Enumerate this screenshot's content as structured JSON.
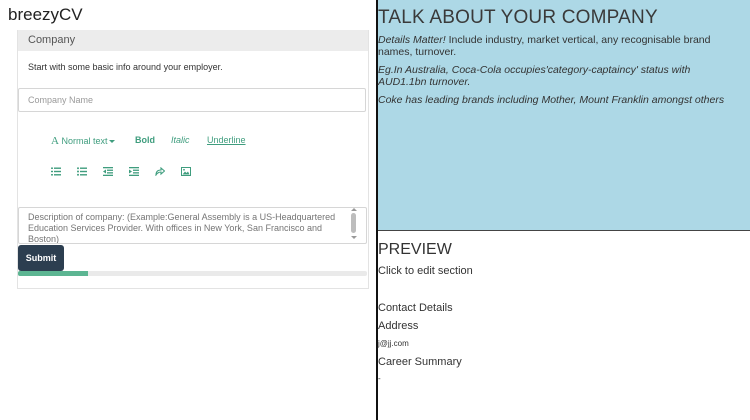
{
  "brand": "breezyCV",
  "form": {
    "panel_title": "Company",
    "intro": "Start with some basic info around your employer.",
    "company_placeholder": "Company Name",
    "toolbar": {
      "normal_icon": "A",
      "normal_label": "Normal text",
      "bold": "Bold",
      "italic": "Italic",
      "underline": "Underline",
      "icons": [
        "list-ordered-icon",
        "list-unordered-icon",
        "outdent-icon",
        "indent-icon",
        "link-icon",
        "image-icon"
      ]
    },
    "description_placeholder": "Description of company: (Example:General Assembly is a US-Headquartered Education Services Provider. With offices in New York, San Francisco and Boston)",
    "submit_label": "Submit",
    "progress": 0.2
  },
  "talk": {
    "title": "TALK ABOUT YOUR COMPANY",
    "p1_em": "Details Matter!",
    "p1_rest": " Include industry, market vertical, any recognisable brand names, turnover.",
    "p2": "Eg.In Australia, Coca-Cola occupies'category-captaincy' status with AUD1.1bn turnover.",
    "p3": "Coke has leading brands including Mother, Mount Franklin amongst others"
  },
  "preview": {
    "title": "PREVIEW",
    "hint": "Click to edit section",
    "contact": "Contact Details",
    "address": "Address",
    "email": "j@jj.com",
    "career": "Career Summary",
    "placeholder": "-"
  },
  "colors": {
    "accent": "#3f9d7e",
    "submit_bg": "#2c3e50",
    "progress_fill": "#5cb592",
    "talk_bg": "#add8e6"
  }
}
